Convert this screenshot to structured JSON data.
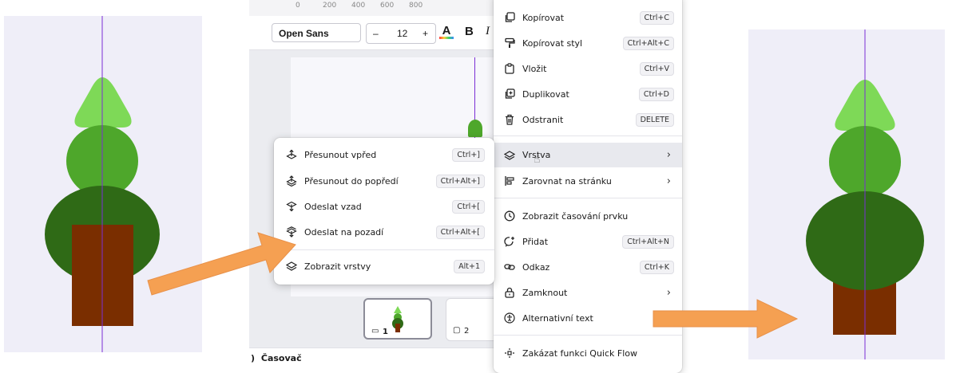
{
  "colors": {
    "panel_bg": "#efeef8",
    "tree_top": "#7ed957",
    "tree_mid": "#4ea72b",
    "tree_crown": "#2f6a16",
    "trunk": "#7a2e00",
    "guide_line": "#7b2fd6",
    "arrow": "#f5a052"
  },
  "ruler": {
    "ticks": [
      "0",
      "200",
      "400",
      "600",
      "800"
    ]
  },
  "toolbar": {
    "font": "Open Sans",
    "decrease": "–",
    "size": "12",
    "increase": "+",
    "text_color_icon": "text-color-icon",
    "bold": "B",
    "italic": "I"
  },
  "pages": [
    {
      "number": "1"
    },
    {
      "number": "2"
    }
  ],
  "bottom_bar": {
    "timer": "Časovač"
  },
  "context_menu": {
    "items": [
      {
        "icon": "copy-icon",
        "label": "Kopírovat",
        "shortcut": "Ctrl+C"
      },
      {
        "icon": "paint-roller-icon",
        "label": "Kopírovat styl",
        "shortcut": "Ctrl+Alt+C"
      },
      {
        "icon": "clipboard-icon",
        "label": "Vložit",
        "shortcut": "Ctrl+V"
      },
      {
        "icon": "duplicate-icon",
        "label": "Duplikovat",
        "shortcut": "Ctrl+D"
      },
      {
        "icon": "trash-icon",
        "label": "Odstranit",
        "shortcut": "DELETE"
      },
      {
        "icon": "layers-icon",
        "label": "Vrstva",
        "submenu": true
      },
      {
        "icon": "align-icon",
        "label": "Zarovnat na stránku",
        "submenu": true
      },
      {
        "icon": "clock-icon",
        "label": "Zobrazit časování prvku"
      },
      {
        "icon": "comment-add-icon",
        "label": "Přidat",
        "shortcut": "Ctrl+Alt+N"
      },
      {
        "icon": "link-icon",
        "label": "Odkaz",
        "shortcut": "Ctrl+K"
      },
      {
        "icon": "lock-icon",
        "label": "Zamknout",
        "submenu": true
      },
      {
        "icon": "accessibility-icon",
        "label": "Alternativní text"
      },
      {
        "icon": "quick-flow-icon",
        "label": "Zakázat funkci Quick Flow"
      }
    ]
  },
  "layer_submenu": {
    "items": [
      {
        "icon": "bring-forward-icon",
        "label": "Přesunout vpřed",
        "shortcut": "Ctrl+]"
      },
      {
        "icon": "bring-to-front-icon",
        "label": "Přesunout do popředí",
        "shortcut": "Ctrl+Alt+]"
      },
      {
        "icon": "send-backward-icon",
        "label": "Odeslat vzad",
        "shortcut": "Ctrl+["
      },
      {
        "icon": "send-to-back-icon",
        "label": "Odeslat na pozadí",
        "shortcut": "Ctrl+Alt+["
      },
      {
        "icon": "layers-icon",
        "label": "Zobrazit vrstvy",
        "shortcut": "Alt+1"
      }
    ]
  }
}
